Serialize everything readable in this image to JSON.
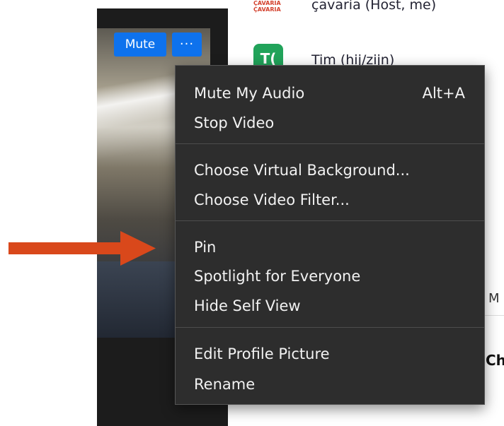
{
  "video": {
    "mute_label": "Mute",
    "more_label": "···"
  },
  "participants": [
    {
      "logo_text": "ÇAVARIA ÇAVARIA",
      "name": "çavaria (Host, me)"
    },
    {
      "avatar": "T(",
      "name": "Tim (hij/zijn)"
    }
  ],
  "side_panel": {
    "partial_label": "M",
    "partial_heading": "Ch"
  },
  "context_menu": {
    "groups": [
      [
        {
          "label": "Mute My Audio",
          "shortcut": "Alt+A"
        },
        {
          "label": "Stop Video"
        }
      ],
      [
        {
          "label": "Choose Virtual Background..."
        },
        {
          "label": "Choose Video Filter..."
        }
      ],
      [
        {
          "label": "Pin"
        },
        {
          "label": "Spotlight for Everyone"
        },
        {
          "label": "Hide Self View"
        }
      ],
      [
        {
          "label": "Edit Profile Picture"
        },
        {
          "label": "Rename"
        }
      ]
    ]
  },
  "colors": {
    "accent_blue": "#0e72ed",
    "menu_bg": "#2d2d2d",
    "arrow": "#d9481b",
    "avatar_green": "#21a35a"
  },
  "icons": {
    "arrow": "arrow-right-icon",
    "more": "more-options-icon"
  }
}
